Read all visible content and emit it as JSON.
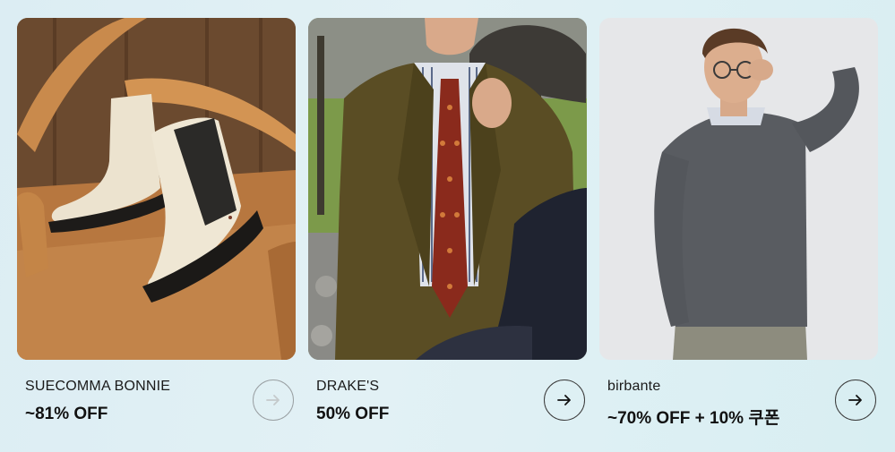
{
  "cards": [
    {
      "brand": "SUECOMMA BONNIE",
      "deal": "~81% OFF",
      "image": "cream-leather-chelsea-boots-on-wooden-chair",
      "button_icon": "arrow-right-icon",
      "button_state": "faded"
    },
    {
      "brand": "DRAKE'S",
      "deal": "50% OFF",
      "image": "man-in-olive-corduroy-jacket-and-patterned-tie",
      "button_icon": "arrow-right-icon",
      "button_state": "active"
    },
    {
      "brand": "birbante",
      "deal": "~70% OFF + 10% 쿠폰",
      "image": "man-in-grey-sweater-with-glasses",
      "button_icon": "arrow-right-icon",
      "button_state": "active"
    }
  ],
  "colors": {
    "background": "#dfeff4",
    "text": "#111111",
    "button_border": "#3a3a3a",
    "button_border_faded": "#9aa0a3"
  }
}
